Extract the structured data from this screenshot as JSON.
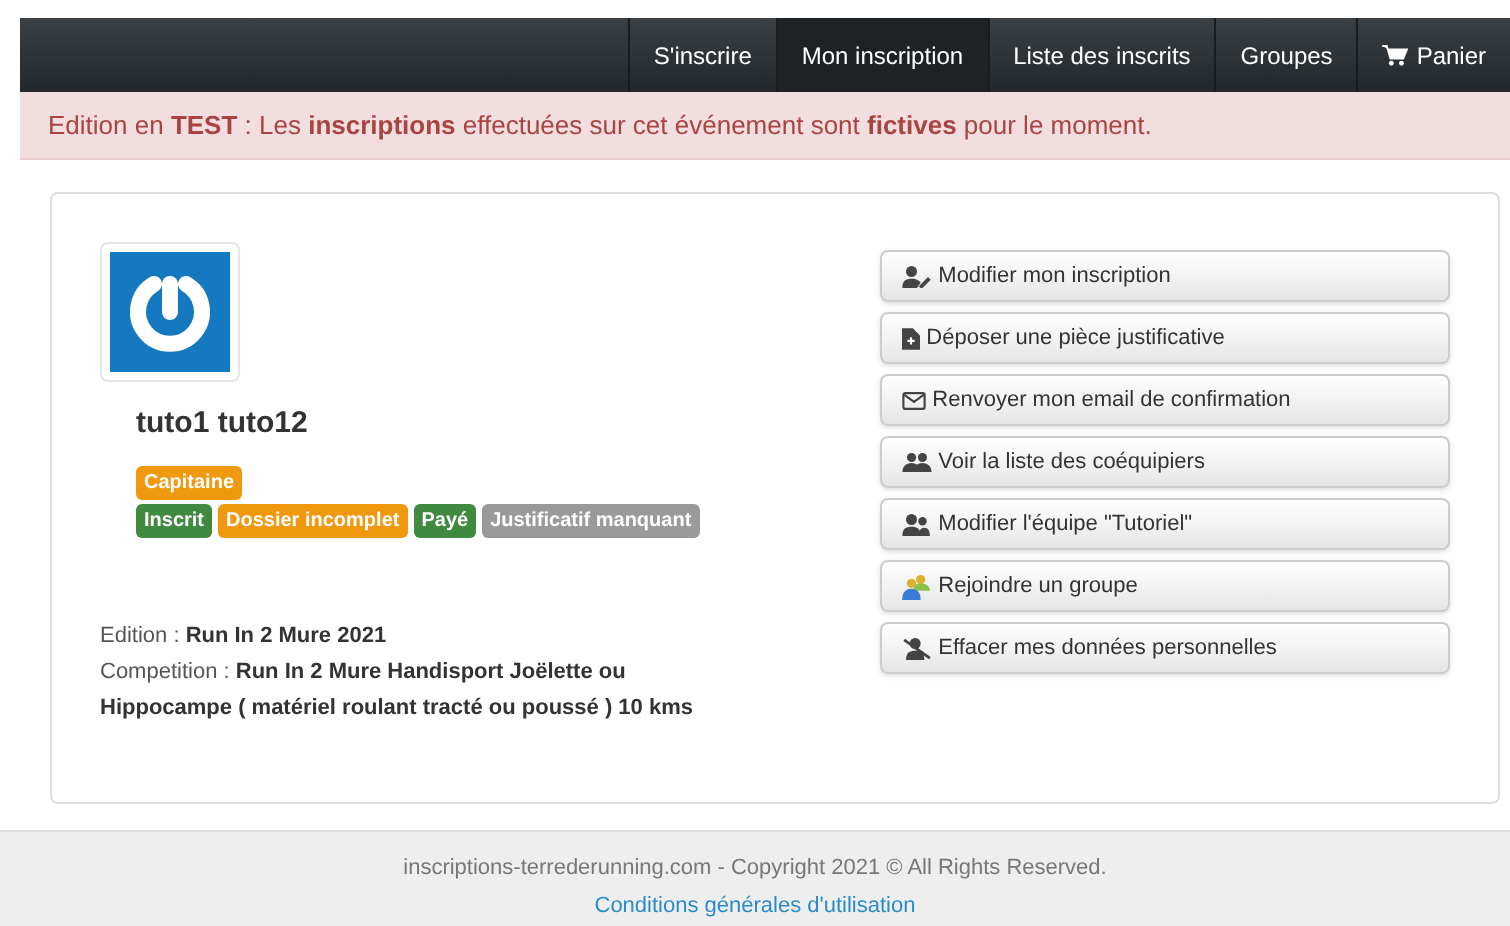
{
  "navbar": {
    "items": [
      {
        "label": "S'inscrire",
        "selected": false
      },
      {
        "label": "Mon inscription",
        "selected": true
      },
      {
        "label": "Liste des inscrits",
        "selected": false
      },
      {
        "label": "Groupes",
        "selected": false
      },
      {
        "label": "Panier",
        "selected": false,
        "kind": "cart"
      }
    ]
  },
  "alert": {
    "text": "Edition en **TEST** : Les **inscriptions** effectuées sur cet événement sont **fictives** pour le moment."
  },
  "profile": {
    "name": "tuto1 tuto12",
    "badge_rows": [
      [
        {
          "label": "Capitaine",
          "color": "#f0980e"
        }
      ],
      [
        {
          "label": "Inscrit",
          "color": "#3f8a3f"
        },
        {
          "label": "Dossier incomplet",
          "color": "#f0980e"
        },
        {
          "label": "Payé",
          "color": "#3f8a3f"
        },
        {
          "label": "Justificatif manquant",
          "color": "#9a9a9a"
        }
      ]
    ],
    "details": [
      {
        "label": "Edition :",
        "value": "Run In 2 Mure 2021"
      },
      {
        "label": "Competition :",
        "value": "Run In 2 Mure Handisport Joëlette ou Hippocampe ( matériel roulant tracté ou poussé ) 10 kms"
      }
    ]
  },
  "actions": [
    {
      "label": "Modifier mon inscription",
      "kind": "user-edit"
    },
    {
      "label": "Déposer une pièce justificative",
      "kind": "file"
    },
    {
      "label": "Renvoyer mon email de confirmation",
      "kind": "mail"
    },
    {
      "label": "Voir la liste des coéquipiers",
      "kind": "users"
    },
    {
      "label": "Modifier l'équipe \"Tutoriel\"",
      "kind": "team"
    },
    {
      "label": "Rejoindre un groupe",
      "kind": "group"
    },
    {
      "label": "Effacer mes données personnelles",
      "kind": "user-remove"
    }
  ],
  "footer": {
    "copyright": "inscriptions-terrederunning.com - Copyright 2021 © All Rights Reserved.",
    "link": "Conditions générales d'utilisation"
  }
}
